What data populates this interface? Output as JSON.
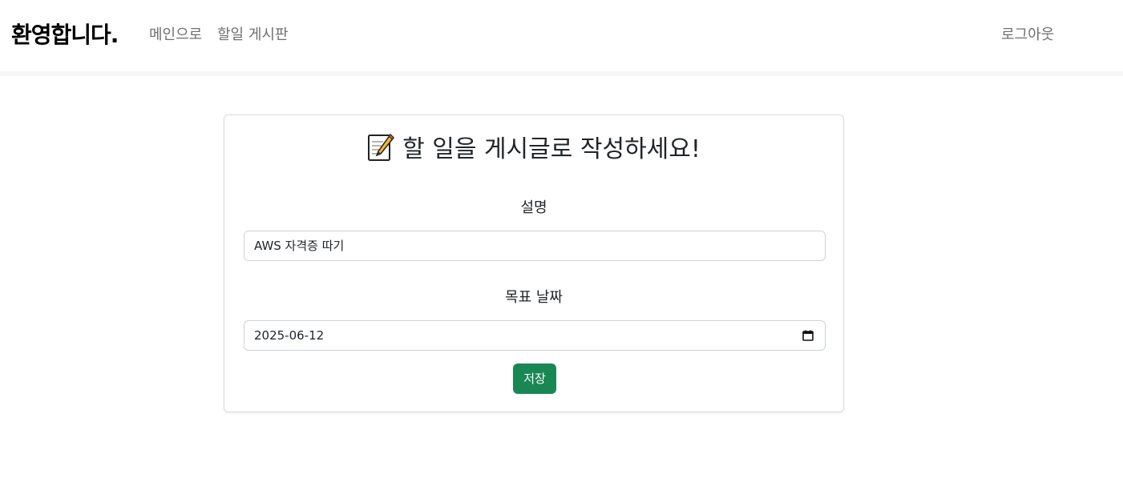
{
  "navbar": {
    "brand": "환영합니다.",
    "links": [
      {
        "label": "메인으로"
      },
      {
        "label": "할일 게시판"
      }
    ],
    "logout_label": "로그아웃"
  },
  "form": {
    "title_icon": "memo-icon",
    "title": "할 일을 게시글로 작성하세요!",
    "description_label": "설명",
    "description_value": "AWS 자격증 따기",
    "date_label": "목표 날짜",
    "date_value": "2025-06-12",
    "date_icon": "calendar-icon",
    "save_label": "저장"
  },
  "colors": {
    "save_button": "#198754",
    "nav_link": "#6f6f6f"
  }
}
